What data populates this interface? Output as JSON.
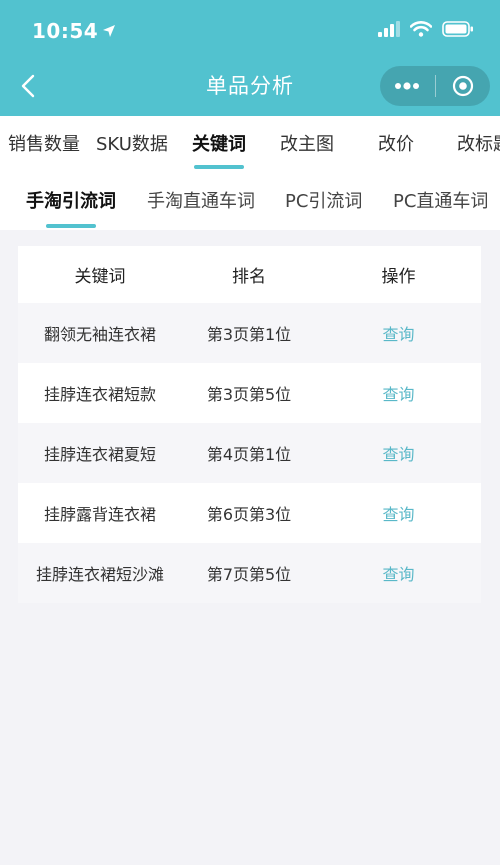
{
  "status_bar": {
    "time": "10:54"
  },
  "nav": {
    "title": "单品分析"
  },
  "primary_tabs": [
    {
      "label": "销售数量"
    },
    {
      "label": "SKU数据"
    },
    {
      "label": "关键词"
    },
    {
      "label": "改主图"
    },
    {
      "label": "改价"
    },
    {
      "label": "改标题"
    }
  ],
  "secondary_tabs": [
    {
      "label": "手淘引流词"
    },
    {
      "label": "手淘直通车词"
    },
    {
      "label": "PC引流词"
    },
    {
      "label": "PC直通车词"
    }
  ],
  "table": {
    "headers": [
      "关键词",
      "排名",
      "操作"
    ],
    "rows": [
      {
        "keyword": "翻领无袖连衣裙",
        "rank": "第3页第1位",
        "action": "查询"
      },
      {
        "keyword": "挂脖连衣裙短款",
        "rank": "第3页第5位",
        "action": "查询"
      },
      {
        "keyword": "挂脖连衣裙夏短",
        "rank": "第4页第1位",
        "action": "查询"
      },
      {
        "keyword": "挂脖露背连衣裙",
        "rank": "第6页第3位",
        "action": "查询"
      },
      {
        "keyword": "挂脖连衣裙短沙滩",
        "rank": "第7页第5位",
        "action": "查询"
      }
    ]
  },
  "colors": {
    "accent": "#52c2cf",
    "link": "#5ab8c8"
  }
}
